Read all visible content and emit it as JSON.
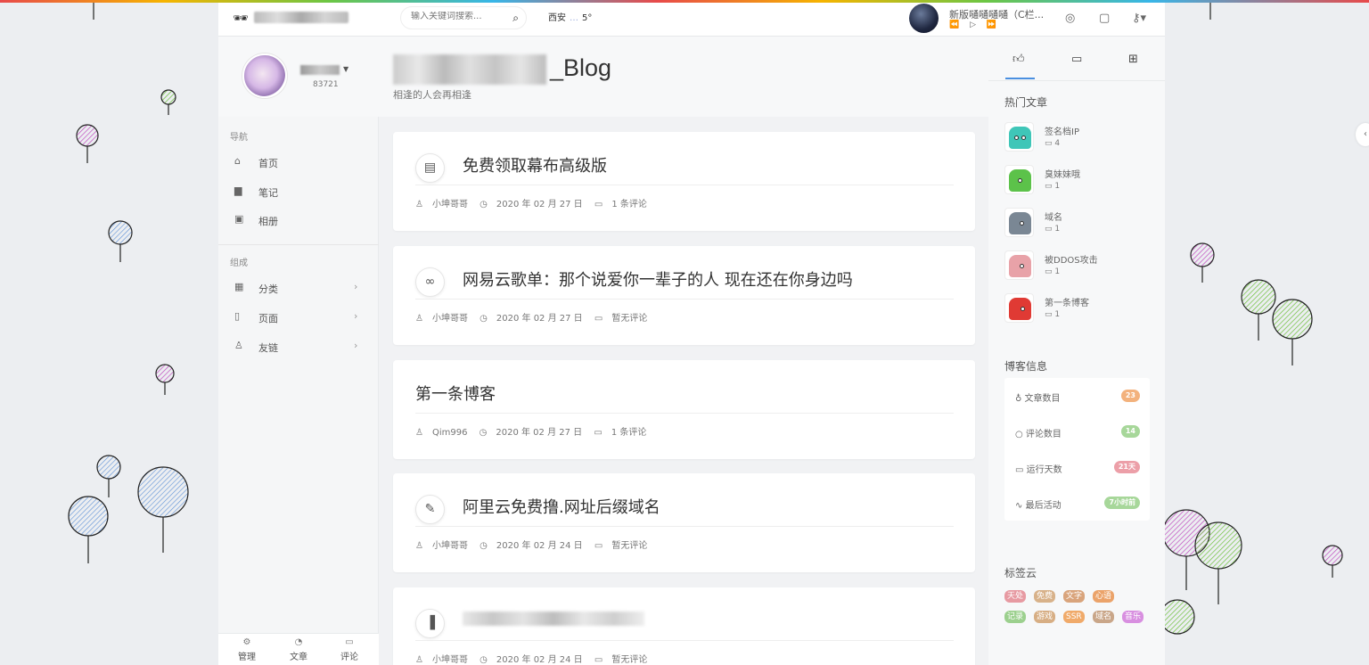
{
  "header": {
    "logo_icon": "sunglasses-icon",
    "search_placeholder": "输入关键词搜索...",
    "weather_city": "西安",
    "weather_temp": "5°",
    "player_title": "新版嗵嗵嗵嗵（C栏...",
    "player_prev": "⏪",
    "player_play": "▷",
    "player_next": "⏩",
    "icon_settings": "◎",
    "icon_chat": "▢",
    "icon_key": "⚷▾"
  },
  "sidebar": {
    "user_id": "83721",
    "nav_heading": "导航",
    "nav_items": [
      {
        "label": "首页",
        "icon": "home-icon"
      },
      {
        "label": "笔记",
        "icon": "notebook-icon"
      },
      {
        "label": "相册",
        "icon": "image-icon"
      }
    ],
    "group_heading": "组成",
    "group_items": [
      {
        "label": "分类",
        "icon": "grid-icon"
      },
      {
        "label": "页面",
        "icon": "file-icon"
      },
      {
        "label": "友链",
        "icon": "user-icon"
      }
    ],
    "bottom_tabs": [
      {
        "label": "管理",
        "icon": "gear-icon"
      },
      {
        "label": "文章",
        "icon": "rss-icon"
      },
      {
        "label": "评论",
        "icon": "comment-icon"
      }
    ]
  },
  "blog": {
    "title_suffix": "_Blog",
    "subtitle": "相逢的人会再相逢"
  },
  "posts": [
    {
      "title": "免费领取幕布高级版",
      "author": "小坤哥哥",
      "date": "2020 年 02 月 27 日",
      "comments": "1 条评论",
      "icon": "document-icon"
    },
    {
      "title": "网易云歌单：那个说爱你一辈子的人 现在还在你身边吗",
      "author": "小坤哥哥",
      "date": "2020 年 02 月 27 日",
      "comments": "暂无评论",
      "icon": "link-icon"
    },
    {
      "title": "第一条博客",
      "author": "Qim996",
      "date": "2020 年 02 月 27 日",
      "comments": "1 条评论",
      "icon": ""
    },
    {
      "title": "阿里云免费撸.网址后缀域名",
      "author": "小坤哥哥",
      "date": "2020 年 02 月 24 日",
      "comments": "暂无评论",
      "icon": "edit-icon"
    },
    {
      "title": "",
      "author": "小坤哥哥",
      "date": "2020 年 02 月 24 日",
      "comments": "暂无评论",
      "icon": "book-icon"
    }
  ],
  "right": {
    "hot_heading": "热门文章",
    "hot_articles": [
      {
        "name": "签名档IP",
        "count": "4",
        "color": "#3fc6b8"
      },
      {
        "name": "臭妹妹哦",
        "count": "1",
        "color": "#5cc24a"
      },
      {
        "name": "域名",
        "count": "1",
        "color": "#7a8794"
      },
      {
        "name": "被DDOS攻击",
        "count": "1",
        "color": "#e8a2a8"
      },
      {
        "name": "第一条博客",
        "count": "1",
        "color": "#e03a34"
      }
    ],
    "info_heading": "博客信息",
    "info_rows": [
      {
        "label": "文章数目",
        "value": "23",
        "color": "#f3b27d",
        "icon": "bulb-icon"
      },
      {
        "label": "评论数目",
        "value": "14",
        "color": "#a7d79a",
        "icon": "comment-icon"
      },
      {
        "label": "运行天数",
        "value": "21天",
        "color": "#ec9fa8",
        "icon": "calendar-icon"
      },
      {
        "label": "最后活动",
        "value": "7小时前",
        "color": "#a7d79a",
        "icon": "pulse-icon"
      }
    ],
    "tags_heading": "标签云",
    "tags": [
      {
        "label": "天处",
        "color": "#e79aa2"
      },
      {
        "label": "免费",
        "color": "#d8b28a"
      },
      {
        "label": "文字",
        "color": "#d9a47c"
      },
      {
        "label": "心语",
        "color": "#eba36a"
      },
      {
        "label": "记录",
        "color": "#9cd08e"
      },
      {
        "label": "游戏",
        "color": "#d7ae84"
      },
      {
        "label": "SSR",
        "color": "#f0aa6a"
      },
      {
        "label": "域名",
        "color": "#c9a689"
      },
      {
        "label": "音乐",
        "color": "#d88fe0"
      }
    ]
  }
}
